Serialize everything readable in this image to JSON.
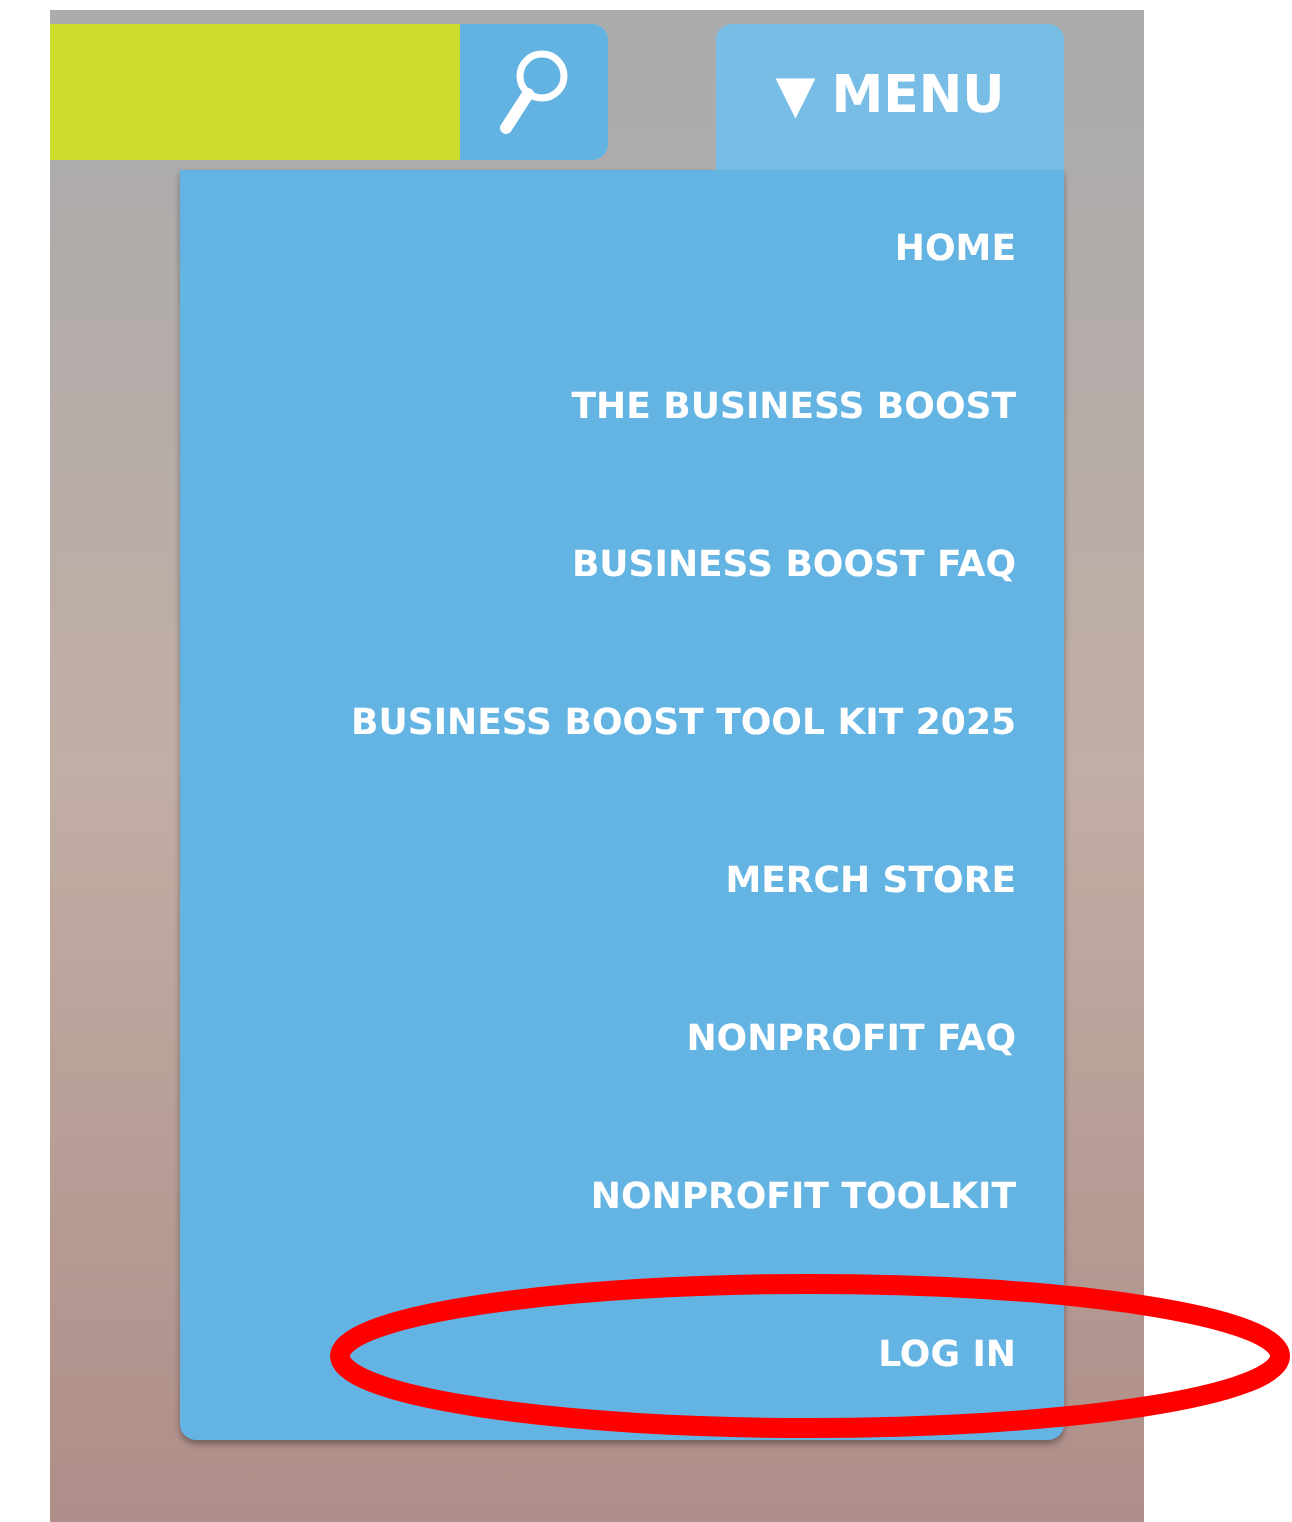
{
  "menu_button": {
    "icon": "▼",
    "label": "MENU",
    "expanded": true
  },
  "menu": {
    "items": [
      {
        "label": "HOME"
      },
      {
        "label": "THE BUSINESS BOOST"
      },
      {
        "label": "BUSINESS BOOST FAQ"
      },
      {
        "label": "BUSINESS BOOST TOOL KIT 2025"
      },
      {
        "label": "MERCH STORE"
      },
      {
        "label": "NONPROFIT FAQ"
      },
      {
        "label": "NONPROFIT TOOLKIT"
      },
      {
        "label": "LOG IN"
      }
    ]
  }
}
